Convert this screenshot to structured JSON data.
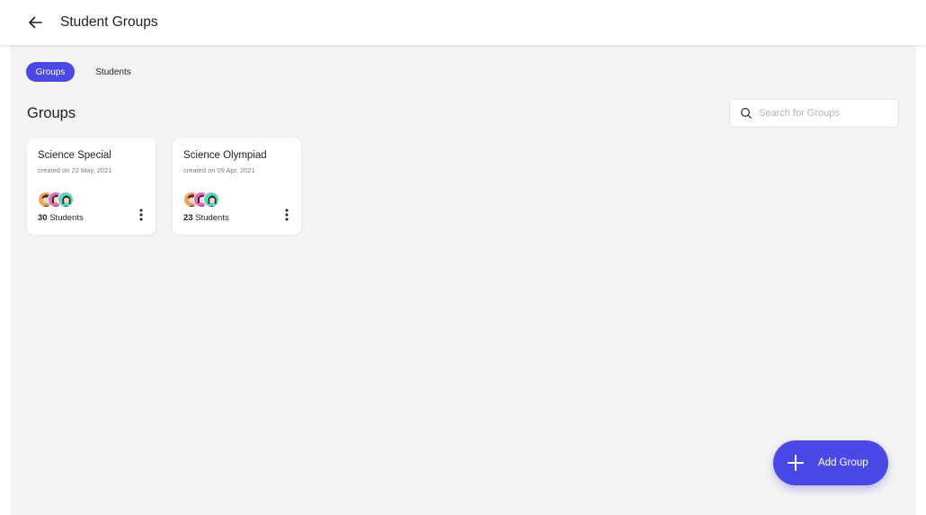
{
  "header": {
    "title": "Student Groups",
    "back_icon": "arrow-left-icon"
  },
  "tabs": [
    {
      "label": "Groups",
      "active": true
    },
    {
      "label": "Students",
      "active": false
    }
  ],
  "section_title": "Groups",
  "search": {
    "placeholder": "Search for Groups",
    "value": "",
    "icon": "search-icon"
  },
  "groups": [
    {
      "name": "Science Special",
      "created": "created on 22 May, 2021",
      "student_count": "30",
      "student_label": " Students"
    },
    {
      "name": "Science Olympiad",
      "created": "created on 09 Apr, 2021",
      "student_count": "23",
      "student_label": " Students"
    }
  ],
  "fab": {
    "label": "Add Group",
    "icon": "plus-icon"
  },
  "colors": {
    "accent": "#4a49e8",
    "background": "#f4f4f4",
    "card": "#ffffff",
    "avatar_1": "#f0a35b",
    "avatar_2": "#e36ab8",
    "avatar_3": "#5fd6c0"
  }
}
